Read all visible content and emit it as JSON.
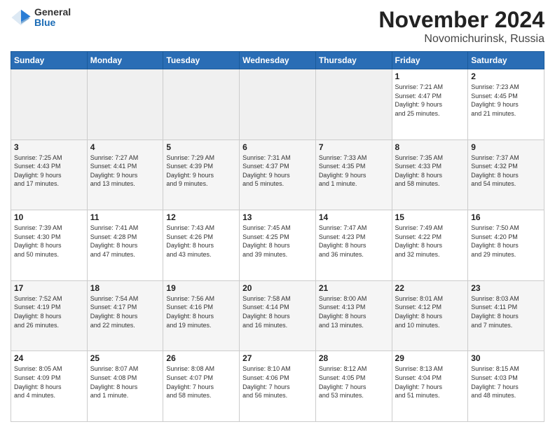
{
  "logo": {
    "general": "General",
    "blue": "Blue"
  },
  "title": {
    "month": "November 2024",
    "location": "Novomichurinsk, Russia"
  },
  "days_header": [
    "Sunday",
    "Monday",
    "Tuesday",
    "Wednesday",
    "Thursday",
    "Friday",
    "Saturday"
  ],
  "weeks": [
    [
      {
        "day": "",
        "info": ""
      },
      {
        "day": "",
        "info": ""
      },
      {
        "day": "",
        "info": ""
      },
      {
        "day": "",
        "info": ""
      },
      {
        "day": "",
        "info": ""
      },
      {
        "day": "1",
        "info": "Sunrise: 7:21 AM\nSunset: 4:47 PM\nDaylight: 9 hours\nand 25 minutes."
      },
      {
        "day": "2",
        "info": "Sunrise: 7:23 AM\nSunset: 4:45 PM\nDaylight: 9 hours\nand 21 minutes."
      }
    ],
    [
      {
        "day": "3",
        "info": "Sunrise: 7:25 AM\nSunset: 4:43 PM\nDaylight: 9 hours\nand 17 minutes."
      },
      {
        "day": "4",
        "info": "Sunrise: 7:27 AM\nSunset: 4:41 PM\nDaylight: 9 hours\nand 13 minutes."
      },
      {
        "day": "5",
        "info": "Sunrise: 7:29 AM\nSunset: 4:39 PM\nDaylight: 9 hours\nand 9 minutes."
      },
      {
        "day": "6",
        "info": "Sunrise: 7:31 AM\nSunset: 4:37 PM\nDaylight: 9 hours\nand 5 minutes."
      },
      {
        "day": "7",
        "info": "Sunrise: 7:33 AM\nSunset: 4:35 PM\nDaylight: 9 hours\nand 1 minute."
      },
      {
        "day": "8",
        "info": "Sunrise: 7:35 AM\nSunset: 4:33 PM\nDaylight: 8 hours\nand 58 minutes."
      },
      {
        "day": "9",
        "info": "Sunrise: 7:37 AM\nSunset: 4:32 PM\nDaylight: 8 hours\nand 54 minutes."
      }
    ],
    [
      {
        "day": "10",
        "info": "Sunrise: 7:39 AM\nSunset: 4:30 PM\nDaylight: 8 hours\nand 50 minutes."
      },
      {
        "day": "11",
        "info": "Sunrise: 7:41 AM\nSunset: 4:28 PM\nDaylight: 8 hours\nand 47 minutes."
      },
      {
        "day": "12",
        "info": "Sunrise: 7:43 AM\nSunset: 4:26 PM\nDaylight: 8 hours\nand 43 minutes."
      },
      {
        "day": "13",
        "info": "Sunrise: 7:45 AM\nSunset: 4:25 PM\nDaylight: 8 hours\nand 39 minutes."
      },
      {
        "day": "14",
        "info": "Sunrise: 7:47 AM\nSunset: 4:23 PM\nDaylight: 8 hours\nand 36 minutes."
      },
      {
        "day": "15",
        "info": "Sunrise: 7:49 AM\nSunset: 4:22 PM\nDaylight: 8 hours\nand 32 minutes."
      },
      {
        "day": "16",
        "info": "Sunrise: 7:50 AM\nSunset: 4:20 PM\nDaylight: 8 hours\nand 29 minutes."
      }
    ],
    [
      {
        "day": "17",
        "info": "Sunrise: 7:52 AM\nSunset: 4:19 PM\nDaylight: 8 hours\nand 26 minutes."
      },
      {
        "day": "18",
        "info": "Sunrise: 7:54 AM\nSunset: 4:17 PM\nDaylight: 8 hours\nand 22 minutes."
      },
      {
        "day": "19",
        "info": "Sunrise: 7:56 AM\nSunset: 4:16 PM\nDaylight: 8 hours\nand 19 minutes."
      },
      {
        "day": "20",
        "info": "Sunrise: 7:58 AM\nSunset: 4:14 PM\nDaylight: 8 hours\nand 16 minutes."
      },
      {
        "day": "21",
        "info": "Sunrise: 8:00 AM\nSunset: 4:13 PM\nDaylight: 8 hours\nand 13 minutes."
      },
      {
        "day": "22",
        "info": "Sunrise: 8:01 AM\nSunset: 4:12 PM\nDaylight: 8 hours\nand 10 minutes."
      },
      {
        "day": "23",
        "info": "Sunrise: 8:03 AM\nSunset: 4:11 PM\nDaylight: 8 hours\nand 7 minutes."
      }
    ],
    [
      {
        "day": "24",
        "info": "Sunrise: 8:05 AM\nSunset: 4:09 PM\nDaylight: 8 hours\nand 4 minutes."
      },
      {
        "day": "25",
        "info": "Sunrise: 8:07 AM\nSunset: 4:08 PM\nDaylight: 8 hours\nand 1 minute."
      },
      {
        "day": "26",
        "info": "Sunrise: 8:08 AM\nSunset: 4:07 PM\nDaylight: 7 hours\nand 58 minutes."
      },
      {
        "day": "27",
        "info": "Sunrise: 8:10 AM\nSunset: 4:06 PM\nDaylight: 7 hours\nand 56 minutes."
      },
      {
        "day": "28",
        "info": "Sunrise: 8:12 AM\nSunset: 4:05 PM\nDaylight: 7 hours\nand 53 minutes."
      },
      {
        "day": "29",
        "info": "Sunrise: 8:13 AM\nSunset: 4:04 PM\nDaylight: 7 hours\nand 51 minutes."
      },
      {
        "day": "30",
        "info": "Sunrise: 8:15 AM\nSunset: 4:03 PM\nDaylight: 7 hours\nand 48 minutes."
      }
    ]
  ],
  "colors": {
    "header_bg": "#2a6db5",
    "header_text": "#ffffff",
    "accent": "#1a6bb5"
  }
}
